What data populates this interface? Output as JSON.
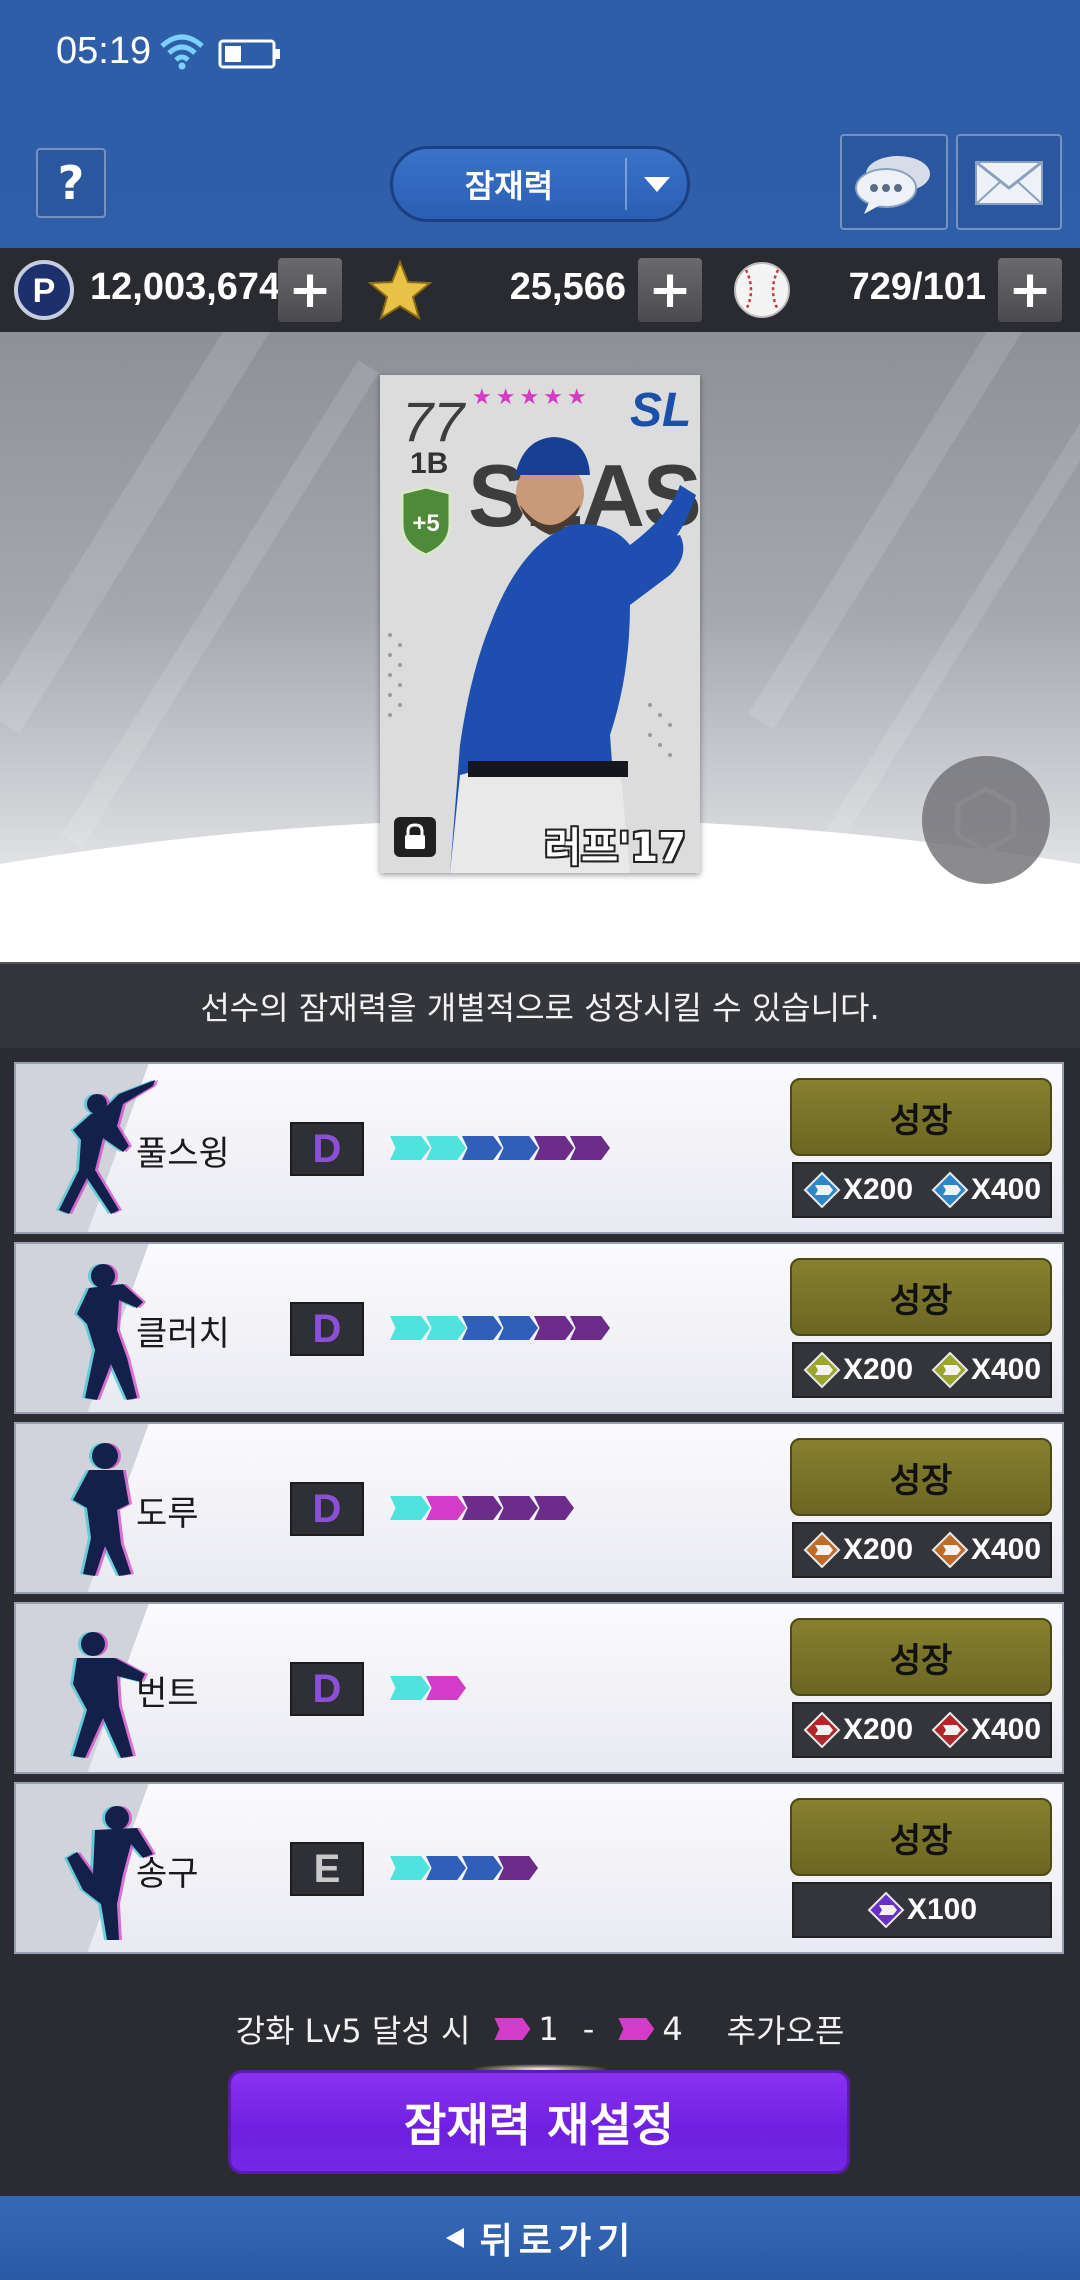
{
  "status_bar": {
    "time": "05:19"
  },
  "header": {
    "help_label": "?",
    "mode_dropdown": {
      "selected": "잠재력"
    }
  },
  "currency": {
    "points": "12,003,674",
    "stars": "25,566",
    "balls": "729/101",
    "plus_label": "+"
  },
  "card": {
    "ovr": "77",
    "position": "1B",
    "enhance": "+5",
    "stars": "★★★★★",
    "team": "SL",
    "season": "SEASON",
    "name": "러프'17"
  },
  "info_text": "선수의 잠재력을 개별적으로 성장시킬 수 있습니다.",
  "potentials": [
    {
      "label": "풀스윙",
      "grade": "D",
      "pips": [
        "#4fe3dd",
        "#4fe3dd",
        "#2f5fb8",
        "#2f5fb8",
        "#6b2c8a",
        "#6b2c8a"
      ],
      "button": "성장",
      "costs": [
        "X200",
        "X400"
      ],
      "gem_color": "#2e86c9"
    },
    {
      "label": "클러치",
      "grade": "D",
      "pips": [
        "#4fe3dd",
        "#4fe3dd",
        "#2f5fb8",
        "#2f5fb8",
        "#6b2c8a",
        "#6b2c8a"
      ],
      "button": "성장",
      "costs": [
        "X200",
        "X400"
      ],
      "gem_color": "#9aa529"
    },
    {
      "label": "도루",
      "grade": "D",
      "pips": [
        "#4fe3dd",
        "#d23cc8",
        "#6b2c8a",
        "#6b2c8a",
        "#6b2c8a"
      ],
      "button": "성장",
      "costs": [
        "X200",
        "X400"
      ],
      "gem_color": "#c06a2a"
    },
    {
      "label": "번트",
      "grade": "D",
      "pips": [
        "#4fe3dd",
        "#d23cc8"
      ],
      "button": "성장",
      "costs": [
        "X200",
        "X400"
      ],
      "gem_color": "#b0262b"
    },
    {
      "label": "송구",
      "grade": "E",
      "pips": [
        "#4fe3dd",
        "#2f5fb8",
        "#2f5fb8",
        "#6b2c8a"
      ],
      "button": "성장",
      "costs": [
        "X100"
      ],
      "gem_color": "#6a2fc8"
    }
  ],
  "unlock_note": {
    "prefix": "강화 Lv5 달성 시",
    "from": "1",
    "dash": "-",
    "to": "4",
    "suffix": "추가오픈"
  },
  "reset_button": "잠재력 재설정",
  "back_button": "뒤로가기"
}
